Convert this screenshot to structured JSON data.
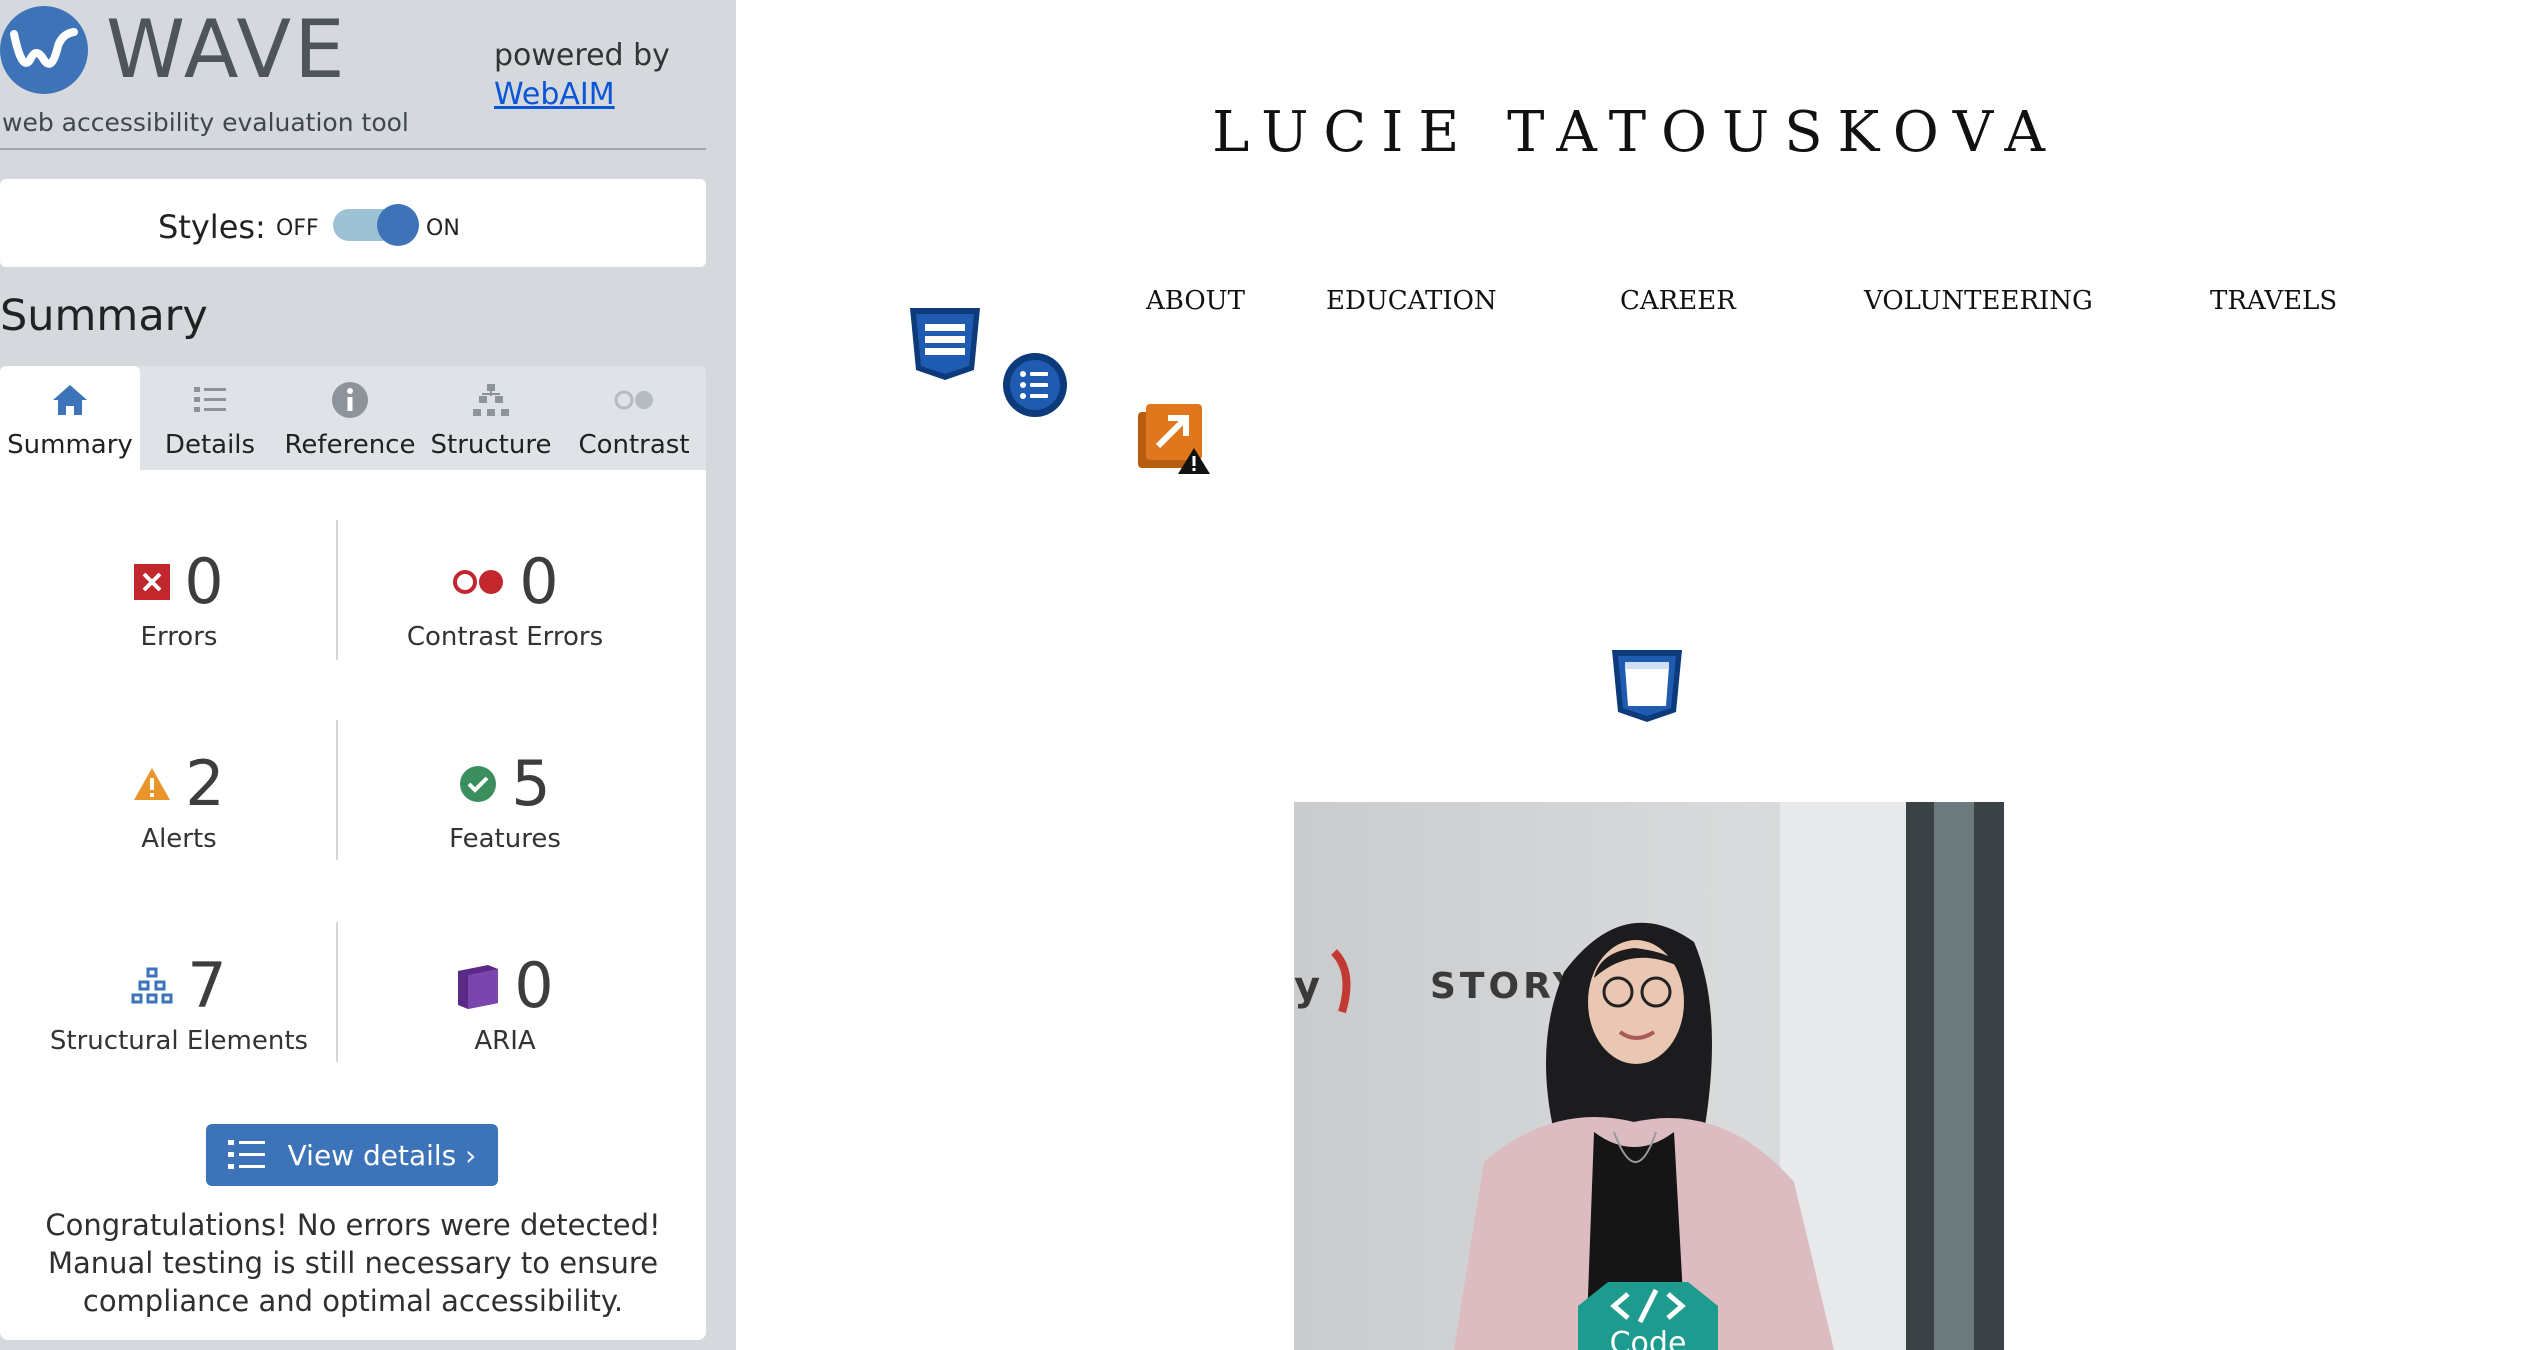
{
  "wave": {
    "title": "WAVE",
    "tagline": "web accessibility evaluation tool",
    "powered_by": "powered by",
    "webaim_link": "WebAIM",
    "styles": {
      "label": "Styles:",
      "off": "OFF",
      "on": "ON",
      "enabled": true
    },
    "summary_heading": "Summary",
    "tabs": [
      {
        "label": "Summary",
        "icon": "home-icon",
        "active": true
      },
      {
        "label": "Details",
        "icon": "list-icon",
        "active": false
      },
      {
        "label": "Reference",
        "icon": "info-icon",
        "active": false
      },
      {
        "label": "Structure",
        "icon": "hierarchy-icon",
        "active": false
      },
      {
        "label": "Contrast",
        "icon": "contrast-icon",
        "active": false
      }
    ],
    "stats": {
      "errors": {
        "count": "0",
        "label": "Errors",
        "icon": "error-icon",
        "color": "#c1272d"
      },
      "contrast_errors": {
        "count": "0",
        "label": "Contrast Errors",
        "icon": "contrast-error-icon",
        "color": "#c1272d"
      },
      "alerts": {
        "count": "2",
        "label": "Alerts",
        "icon": "alert-icon",
        "color": "#e8962b"
      },
      "features": {
        "count": "5",
        "label": "Features",
        "icon": "feature-check-icon",
        "color": "#3a8f5c"
      },
      "structural": {
        "count": "7",
        "label": "Structural Elements",
        "icon": "structure-icon",
        "color": "#3d73b9"
      },
      "aria": {
        "count": "0",
        "label": "ARIA",
        "icon": "aria-icon",
        "color": "#5b2a86"
      }
    },
    "view_details": "View details ›",
    "congrats": "Congratulations! No errors were detected! Manual testing is still necessary to ensure compliance and optimal accessibility."
  },
  "page": {
    "title": "LUCIE TATOUSKOVA",
    "nav": [
      "ABOUT",
      "EDUCATION",
      "CAREER",
      "VOLUNTEERING",
      "TRAVELS"
    ],
    "photo_text": "STORY",
    "code_badge": "Code"
  },
  "colors": {
    "sidebar_bg": "#d5d9de",
    "accent_blue": "#3d73b9",
    "wave_navy": "#0d3a7a",
    "alert_orange": "#e0771d",
    "code_teal": "#1e9b8f"
  }
}
